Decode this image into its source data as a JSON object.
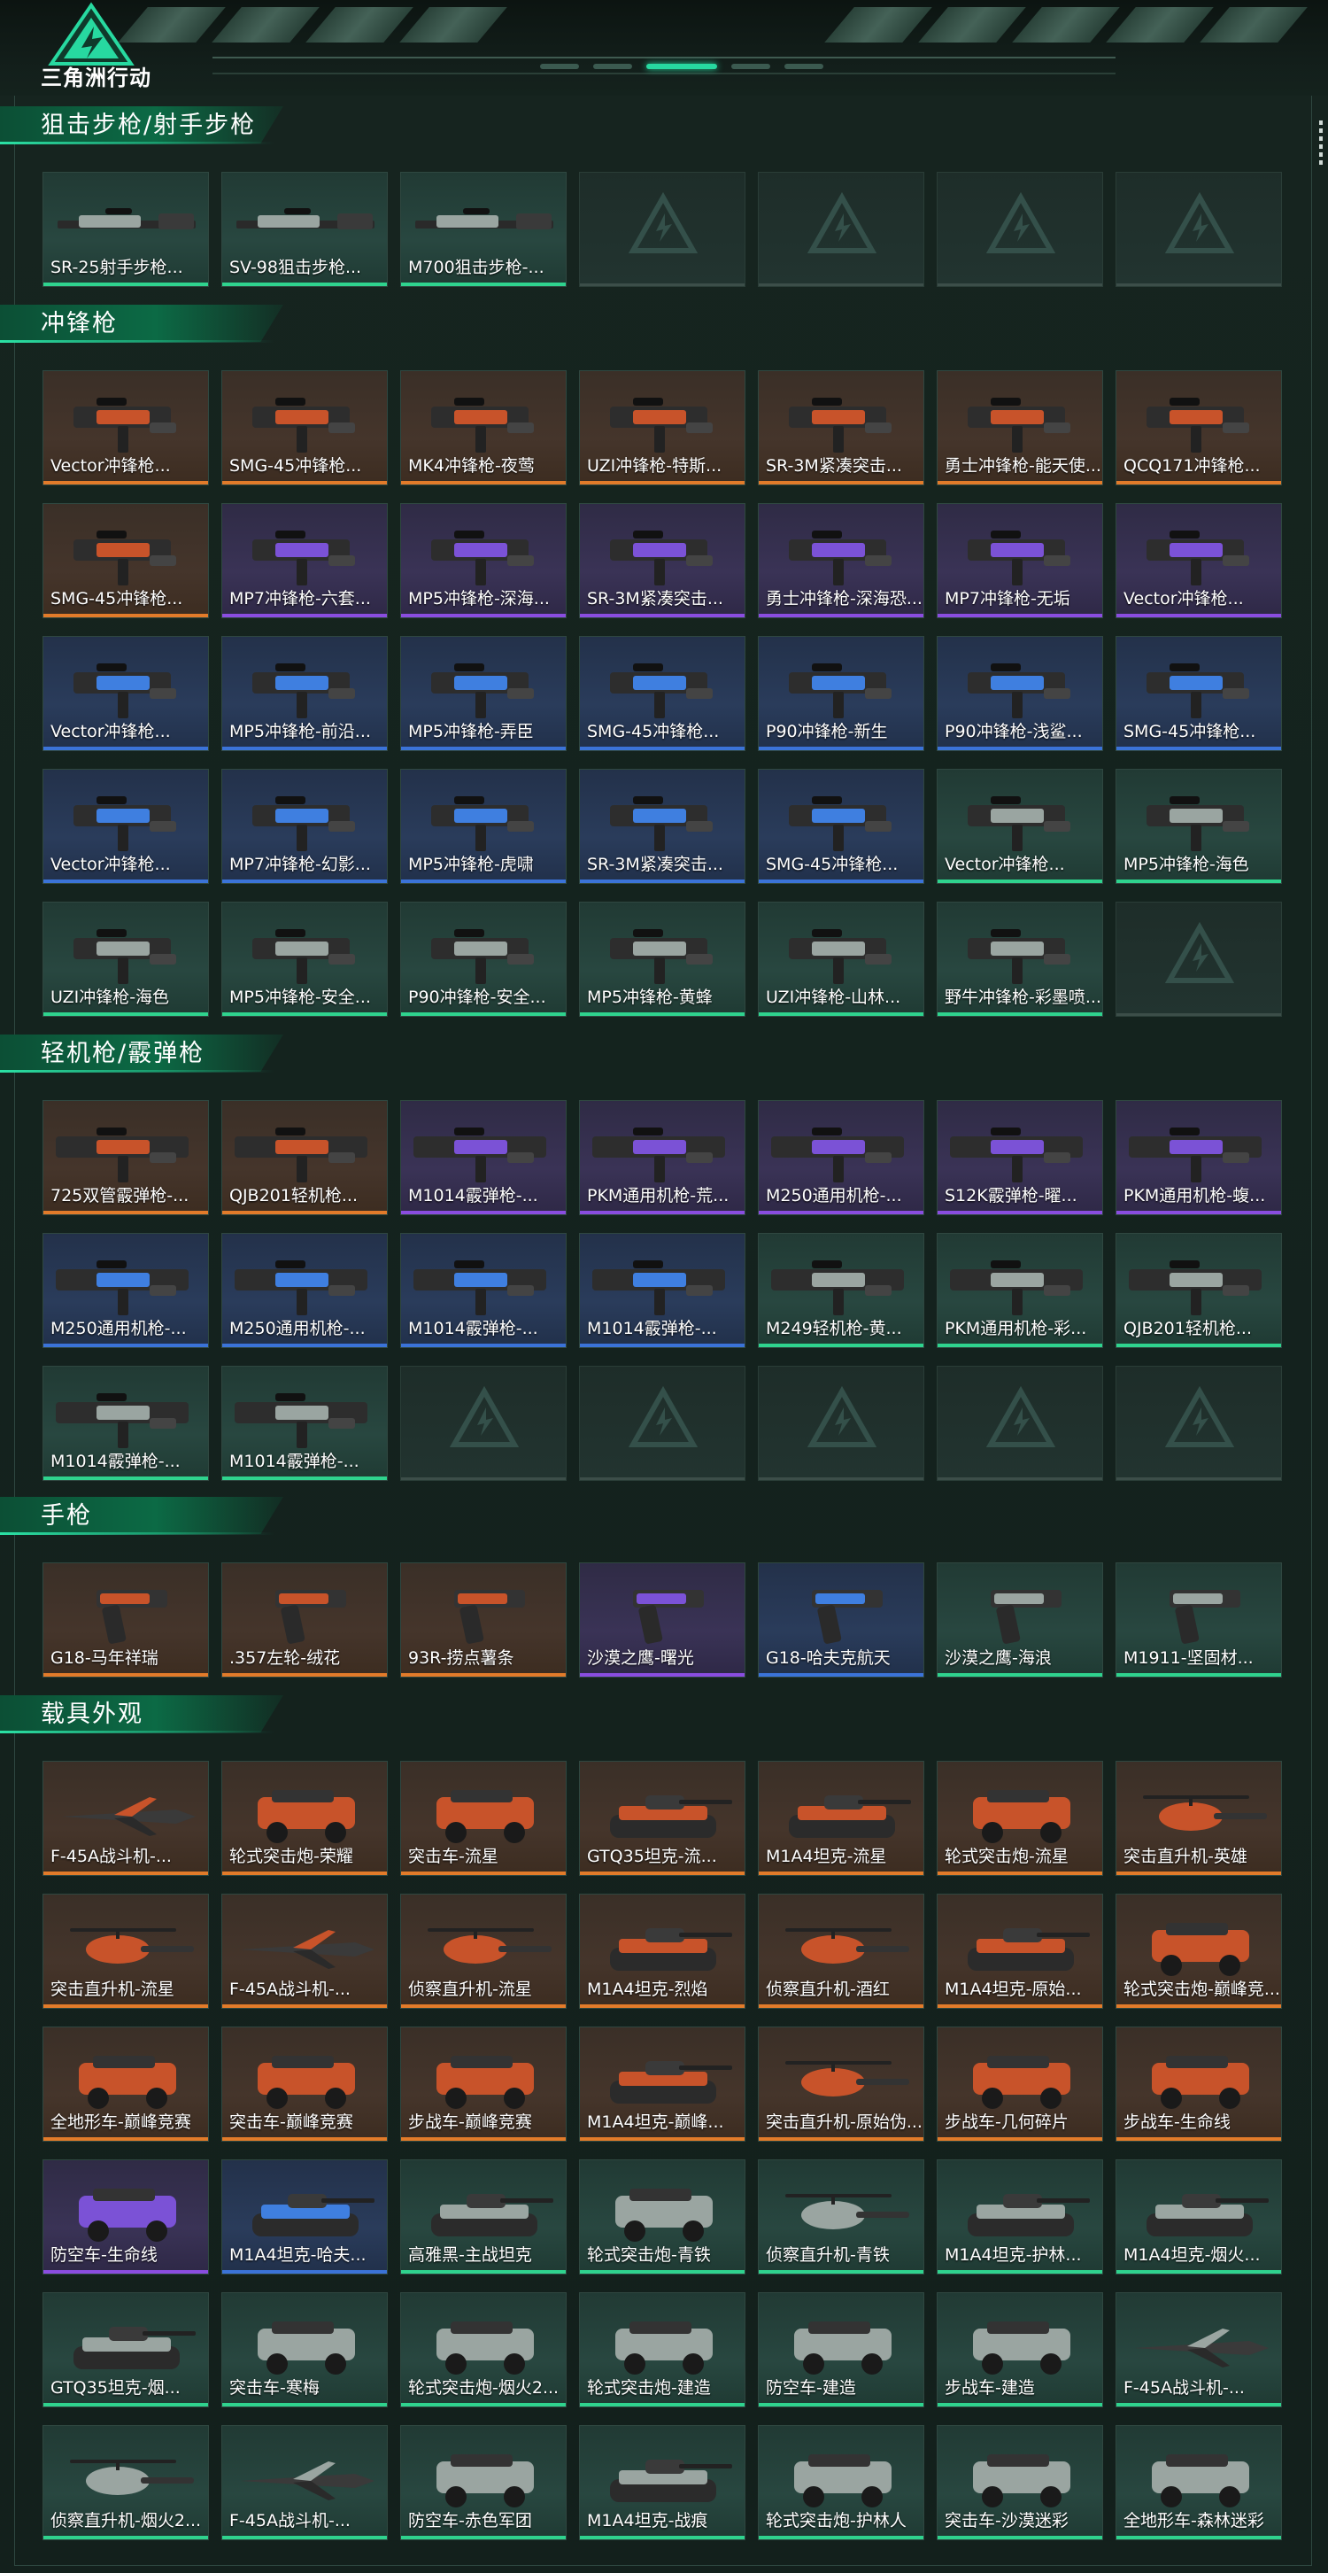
{
  "app": {
    "logo_text": "三角洲行动"
  },
  "colors": {
    "accent": "#27d9a0",
    "rarity_orange": "#e27b2a",
    "rarity_purple": "#8a4de0",
    "rarity_blue": "#3b73d8",
    "rarity_green": "#2fd38e"
  },
  "sections": [
    {
      "title": "狙击步枪/射手步枪",
      "items": [
        {
          "label": "SR-25射手步枪...",
          "rarity": "green",
          "icon": "rifle"
        },
        {
          "label": "SV-98狙击步枪...",
          "rarity": "green",
          "icon": "rifle"
        },
        {
          "label": "M700狙击步枪-...",
          "rarity": "green",
          "icon": "rifle"
        },
        {
          "label": "",
          "rarity": "empty",
          "icon": "placeholder-logo"
        },
        {
          "label": "",
          "rarity": "empty",
          "icon": "placeholder-logo"
        },
        {
          "label": "",
          "rarity": "empty",
          "icon": "placeholder-logo"
        },
        {
          "label": "",
          "rarity": "empty",
          "icon": "placeholder-logo"
        }
      ]
    },
    {
      "title": "冲锋枪",
      "items": [
        {
          "label": "Vector冲锋枪...",
          "rarity": "orange",
          "icon": "smg"
        },
        {
          "label": "SMG-45冲锋枪...",
          "rarity": "orange",
          "icon": "smg"
        },
        {
          "label": "MK4冲锋枪-夜莺",
          "rarity": "orange",
          "icon": "smg"
        },
        {
          "label": "UZI冲锋枪-特斯...",
          "rarity": "orange",
          "icon": "smg"
        },
        {
          "label": "SR-3M紧凑突击...",
          "rarity": "orange",
          "icon": "smg"
        },
        {
          "label": "勇士冲锋枪-能天使...",
          "rarity": "orange",
          "icon": "smg"
        },
        {
          "label": "QCQ171冲锋枪...",
          "rarity": "orange",
          "icon": "smg"
        },
        {
          "label": "SMG-45冲锋枪...",
          "rarity": "orange",
          "icon": "smg"
        },
        {
          "label": "MP7冲锋枪-六套...",
          "rarity": "purple",
          "icon": "smg"
        },
        {
          "label": "MP5冲锋枪-深海...",
          "rarity": "purple",
          "icon": "smg"
        },
        {
          "label": "SR-3M紧凑突击...",
          "rarity": "purple",
          "icon": "smg"
        },
        {
          "label": "勇士冲锋枪-深海恐...",
          "rarity": "purple",
          "icon": "smg"
        },
        {
          "label": "MP7冲锋枪-无垢",
          "rarity": "purple",
          "icon": "smg"
        },
        {
          "label": "Vector冲锋枪...",
          "rarity": "purple",
          "icon": "smg"
        },
        {
          "label": "Vector冲锋枪...",
          "rarity": "blue",
          "icon": "smg"
        },
        {
          "label": "MP5冲锋枪-前沿...",
          "rarity": "blue",
          "icon": "smg"
        },
        {
          "label": "MP5冲锋枪-弄臣",
          "rarity": "blue",
          "icon": "smg"
        },
        {
          "label": "SMG-45冲锋枪...",
          "rarity": "blue",
          "icon": "smg"
        },
        {
          "label": "P90冲锋枪-新生",
          "rarity": "blue",
          "icon": "smg"
        },
        {
          "label": "P90冲锋枪-浅鲨...",
          "rarity": "blue",
          "icon": "smg"
        },
        {
          "label": "SMG-45冲锋枪...",
          "rarity": "blue",
          "icon": "smg"
        },
        {
          "label": "Vector冲锋枪...",
          "rarity": "blue",
          "icon": "smg"
        },
        {
          "label": "MP7冲锋枪-幻影...",
          "rarity": "blue",
          "icon": "smg"
        },
        {
          "label": "MP5冲锋枪-虎啸",
          "rarity": "blue",
          "icon": "smg"
        },
        {
          "label": "SR-3M紧凑突击...",
          "rarity": "blue",
          "icon": "smg"
        },
        {
          "label": "SMG-45冲锋枪...",
          "rarity": "blue",
          "icon": "smg"
        },
        {
          "label": "Vector冲锋枪...",
          "rarity": "green",
          "icon": "smg"
        },
        {
          "label": "MP5冲锋枪-海色",
          "rarity": "green",
          "icon": "smg"
        },
        {
          "label": "UZI冲锋枪-海色",
          "rarity": "green",
          "icon": "smg"
        },
        {
          "label": "MP5冲锋枪-安全...",
          "rarity": "green",
          "icon": "smg"
        },
        {
          "label": "P90冲锋枪-安全...",
          "rarity": "green",
          "icon": "smg"
        },
        {
          "label": "MP5冲锋枪-黄蜂",
          "rarity": "green",
          "icon": "smg"
        },
        {
          "label": "UZI冲锋枪-山林...",
          "rarity": "green",
          "icon": "smg"
        },
        {
          "label": "野牛冲锋枪-彩墨喷...",
          "rarity": "green",
          "icon": "smg"
        },
        {
          "label": "",
          "rarity": "empty",
          "icon": "placeholder-logo"
        }
      ]
    },
    {
      "title": "轻机枪/霰弹枪",
      "items": [
        {
          "label": "725双管霰弹枪-...",
          "rarity": "orange",
          "icon": "lmg"
        },
        {
          "label": "QJB201轻机枪...",
          "rarity": "orange",
          "icon": "lmg"
        },
        {
          "label": "M1014霰弹枪-...",
          "rarity": "purple",
          "icon": "lmg"
        },
        {
          "label": "PKM通用机枪-荒...",
          "rarity": "purple",
          "icon": "lmg"
        },
        {
          "label": "M250通用机枪-...",
          "rarity": "purple",
          "icon": "lmg"
        },
        {
          "label": "S12K霰弹枪-曜...",
          "rarity": "purple",
          "icon": "lmg"
        },
        {
          "label": "PKM通用机枪-蝮...",
          "rarity": "purple",
          "icon": "lmg"
        },
        {
          "label": "M250通用机枪-...",
          "rarity": "blue",
          "icon": "lmg"
        },
        {
          "label": "M250通用机枪-...",
          "rarity": "blue",
          "icon": "lmg"
        },
        {
          "label": "M1014霰弹枪-...",
          "rarity": "blue",
          "icon": "lmg"
        },
        {
          "label": "M1014霰弹枪-...",
          "rarity": "blue",
          "icon": "lmg"
        },
        {
          "label": "M249轻机枪-黄...",
          "rarity": "green",
          "icon": "lmg"
        },
        {
          "label": "PKM通用机枪-彩...",
          "rarity": "green",
          "icon": "lmg"
        },
        {
          "label": "QJB201轻机枪...",
          "rarity": "green",
          "icon": "lmg"
        },
        {
          "label": "M1014霰弹枪-...",
          "rarity": "green",
          "icon": "lmg"
        },
        {
          "label": "M1014霰弹枪-...",
          "rarity": "green",
          "icon": "lmg"
        },
        {
          "label": "",
          "rarity": "empty",
          "icon": "placeholder-logo"
        },
        {
          "label": "",
          "rarity": "empty",
          "icon": "placeholder-logo"
        },
        {
          "label": "",
          "rarity": "empty",
          "icon": "placeholder-logo"
        },
        {
          "label": "",
          "rarity": "empty",
          "icon": "placeholder-logo"
        },
        {
          "label": "",
          "rarity": "empty",
          "icon": "placeholder-logo"
        }
      ]
    },
    {
      "title": "手枪",
      "items": [
        {
          "label": "G18-马年祥瑞",
          "rarity": "orange",
          "icon": "pistol"
        },
        {
          "label": ".357左轮-绒花",
          "rarity": "orange",
          "icon": "pistol"
        },
        {
          "label": "93R-捞点薯条",
          "rarity": "orange",
          "icon": "pistol"
        },
        {
          "label": "沙漠之鹰-曙光",
          "rarity": "purple",
          "icon": "pistol"
        },
        {
          "label": "G18-哈夫克航天",
          "rarity": "blue",
          "icon": "pistol"
        },
        {
          "label": "沙漠之鹰-海浪",
          "rarity": "green",
          "icon": "pistol"
        },
        {
          "label": "M1911-坚固材...",
          "rarity": "green",
          "icon": "pistol"
        }
      ]
    },
    {
      "title": "载具外观",
      "items": [
        {
          "label": "F-45A战斗机-...",
          "rarity": "orange",
          "icon": "jet"
        },
        {
          "label": "轮式突击炮-荣耀",
          "rarity": "orange",
          "icon": "car"
        },
        {
          "label": "突击车-流星",
          "rarity": "orange",
          "icon": "car"
        },
        {
          "label": "GTQ35坦克-流...",
          "rarity": "orange",
          "icon": "tank"
        },
        {
          "label": "M1A4坦克-流星",
          "rarity": "orange",
          "icon": "tank"
        },
        {
          "label": "轮式突击炮-流星",
          "rarity": "orange",
          "icon": "car"
        },
        {
          "label": "突击直升机-英雄",
          "rarity": "orange",
          "icon": "heli"
        },
        {
          "label": "突击直升机-流星",
          "rarity": "orange",
          "icon": "heli"
        },
        {
          "label": "F-45A战斗机-...",
          "rarity": "orange",
          "icon": "jet"
        },
        {
          "label": "侦察直升机-流星",
          "rarity": "orange",
          "icon": "heli"
        },
        {
          "label": "M1A4坦克-烈焰",
          "rarity": "orange",
          "icon": "tank"
        },
        {
          "label": "侦察直升机-酒红",
          "rarity": "orange",
          "icon": "heli"
        },
        {
          "label": "M1A4坦克-原始...",
          "rarity": "orange",
          "icon": "tank"
        },
        {
          "label": "轮式突击炮-巅峰竞...",
          "rarity": "orange",
          "icon": "car"
        },
        {
          "label": "全地形车-巅峰竞赛",
          "rarity": "orange",
          "icon": "car"
        },
        {
          "label": "突击车-巅峰竞赛",
          "rarity": "orange",
          "icon": "car"
        },
        {
          "label": "步战车-巅峰竞赛",
          "rarity": "orange",
          "icon": "car"
        },
        {
          "label": "M1A4坦克-巅峰...",
          "rarity": "orange",
          "icon": "tank"
        },
        {
          "label": "突击直升机-原始伪...",
          "rarity": "orange",
          "icon": "heli"
        },
        {
          "label": "步战车-几何碎片",
          "rarity": "orange",
          "icon": "car"
        },
        {
          "label": "步战车-生命线",
          "rarity": "orange",
          "icon": "car"
        },
        {
          "label": "防空车-生命线",
          "rarity": "purple",
          "icon": "car"
        },
        {
          "label": "M1A4坦克-哈夫...",
          "rarity": "blue",
          "icon": "tank"
        },
        {
          "label": "高雅黑-主战坦克",
          "rarity": "green",
          "icon": "tank"
        },
        {
          "label": "轮式突击炮-青铁",
          "rarity": "green",
          "icon": "car"
        },
        {
          "label": "侦察直升机-青铁",
          "rarity": "green",
          "icon": "heli"
        },
        {
          "label": "M1A4坦克-护林...",
          "rarity": "green",
          "icon": "tank"
        },
        {
          "label": "M1A4坦克-烟火...",
          "rarity": "green",
          "icon": "tank"
        },
        {
          "label": "GTQ35坦克-烟...",
          "rarity": "green",
          "icon": "tank"
        },
        {
          "label": "突击车-寒梅",
          "rarity": "green",
          "icon": "car"
        },
        {
          "label": "轮式突击炮-烟火2...",
          "rarity": "green",
          "icon": "car"
        },
        {
          "label": "轮式突击炮-建造",
          "rarity": "green",
          "icon": "car"
        },
        {
          "label": "防空车-建造",
          "rarity": "green",
          "icon": "car"
        },
        {
          "label": "步战车-建造",
          "rarity": "green",
          "icon": "car"
        },
        {
          "label": "F-45A战斗机-...",
          "rarity": "green",
          "icon": "jet"
        },
        {
          "label": "侦察直升机-烟火2...",
          "rarity": "green",
          "icon": "heli"
        },
        {
          "label": "F-45A战斗机-...",
          "rarity": "green",
          "icon": "jet"
        },
        {
          "label": "防空车-赤色军团",
          "rarity": "green",
          "icon": "car"
        },
        {
          "label": "M1A4坦克-战痕",
          "rarity": "green",
          "icon": "tank"
        },
        {
          "label": "轮式突击炮-护林人",
          "rarity": "green",
          "icon": "car"
        },
        {
          "label": "突击车-沙漠迷彩",
          "rarity": "green",
          "icon": "car"
        },
        {
          "label": "全地形车-森林迷彩",
          "rarity": "green",
          "icon": "car"
        }
      ]
    }
  ]
}
